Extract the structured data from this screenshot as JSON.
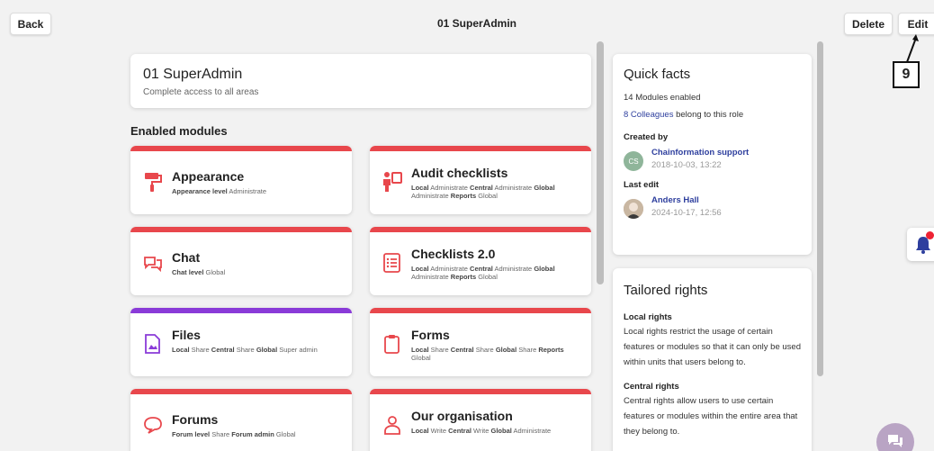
{
  "topbar": {
    "back_label": "Back",
    "title": "01 SuperAdmin",
    "delete_label": "Delete",
    "edit_label": "Edit"
  },
  "role": {
    "name": "01 SuperAdmin",
    "description": "Complete access to all areas"
  },
  "modules_heading": "Enabled modules",
  "modules": [
    {
      "title": "Appearance",
      "accent": "#e8474c",
      "icon": "paint-roller-icon",
      "rights": [
        [
          "Appearance level",
          "Administrate"
        ]
      ]
    },
    {
      "title": "Audit checklists",
      "accent": "#e8474c",
      "icon": "auditor-icon",
      "rights": [
        [
          "Local",
          "Administrate"
        ],
        [
          "Central",
          "Administrate"
        ],
        [
          "Global",
          "Administrate"
        ],
        [
          "Reports",
          "Global"
        ]
      ]
    },
    {
      "title": "Chat",
      "accent": "#e8474c",
      "icon": "chat-bubbles-icon",
      "rights": [
        [
          "Chat level",
          "Global"
        ]
      ]
    },
    {
      "title": "Checklists 2.0",
      "accent": "#e8474c",
      "icon": "checklist-icon",
      "rights": [
        [
          "Local",
          "Administrate"
        ],
        [
          "Central",
          "Administrate"
        ],
        [
          "Global",
          "Administrate"
        ],
        [
          "Reports",
          "Global"
        ]
      ]
    },
    {
      "title": "Files",
      "accent": "#8a3bd8",
      "icon": "file-image-icon",
      "rights": [
        [
          "Local",
          "Share"
        ],
        [
          "Central",
          "Share"
        ],
        [
          "Global",
          "Super admin"
        ]
      ]
    },
    {
      "title": "Forms",
      "accent": "#e8474c",
      "icon": "clipboard-icon",
      "rights": [
        [
          "Local",
          "Share"
        ],
        [
          "Central",
          "Share"
        ],
        [
          "Global",
          "Share"
        ],
        [
          "Reports",
          "Global"
        ]
      ]
    },
    {
      "title": "Forums",
      "accent": "#e8474c",
      "icon": "speech-bubble-icon",
      "rights": [
        [
          "Forum level",
          "Share"
        ],
        [
          "Forum admin",
          "Global"
        ]
      ]
    },
    {
      "title": "Our organisation",
      "accent": "#e8474c",
      "icon": "person-icon",
      "rights": [
        [
          "Local",
          "Write"
        ],
        [
          "Central",
          "Write"
        ],
        [
          "Global",
          "Administrate"
        ]
      ]
    }
  ],
  "quick_facts": {
    "title": "Quick facts",
    "modules_enabled": "14 Modules enabled",
    "colleagues_link": "8 Colleagues",
    "colleagues_suffix": " belong to this role",
    "created_by_label": "Created by",
    "created_by": {
      "initials": "CS",
      "name": "Chainformation support",
      "date": "2018-10-03, 13:22"
    },
    "last_edit_label": "Last edit",
    "last_edit": {
      "name": "Anders Hall",
      "date": "2024-10-17, 12:56"
    }
  },
  "tailored_rights": {
    "title": "Tailored rights",
    "local_heading": "Local rights",
    "local_text": "Local rights restrict the usage of certain features or modules so that it can only be used within units that users belong to.",
    "central_heading": "Central rights",
    "central_text": "Central rights allow users to use certain features or modules within the entire area that they belong to."
  },
  "annotation": {
    "step": "9"
  }
}
